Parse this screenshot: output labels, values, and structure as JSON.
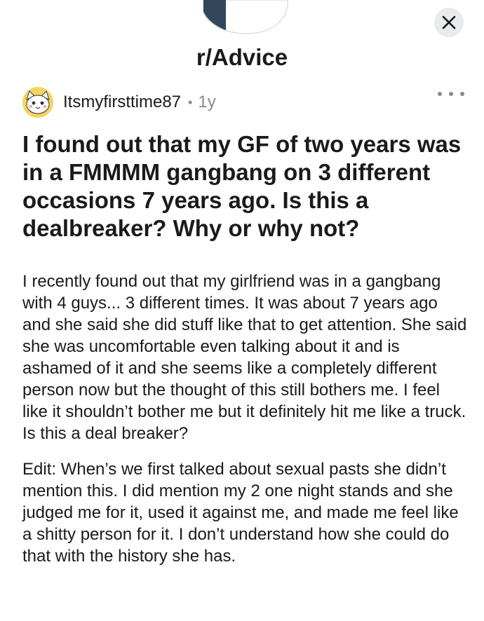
{
  "header": {
    "subreddit": "r/Advice",
    "close_icon": "close-icon"
  },
  "post": {
    "author": "Itsmyfirsttime87",
    "separator": "•",
    "age": "1y",
    "more_icon": "more-options-icon",
    "title": "I found out that my GF of two years was in a FMMMM gangbang on 3 different occasions 7 years ago. Is this a dealbreaker? Why or why not?",
    "body": [
      "I recently found out that my girlfriend was in a gangbang with 4 guys... 3 different times. It was about 7 years ago and she said she did stuff like that to get attention. She said she was uncomfortable even talking about it and is ashamed of it and she seems like a completely different person now but the thought of this still bothers me. I feel like it shouldn’t bother me but it definitely hit me like a truck. Is this a deal breaker?",
      "Edit: When’s we first talked about sexual pasts she didn’t mention this. I did mention my 2 one night stands and she judged me for it, used it against me, and made me feel like a shitty person for it. I don’t understand how she could do that with the history she has."
    ]
  },
  "colors": {
    "text": "#1a1a1b",
    "muted": "#878a8c",
    "close_bg": "#e9eaec",
    "header_art_dark": "#33475b"
  }
}
